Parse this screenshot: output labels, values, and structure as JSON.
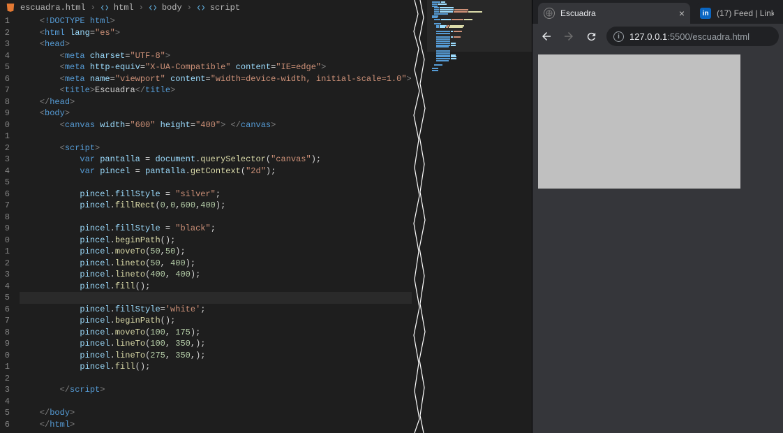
{
  "breadcrumbs": {
    "file": "escuadra.html",
    "path": [
      "html",
      "body",
      "script"
    ]
  },
  "code": {
    "lines": [
      {
        "n": "1",
        "kind": "tag",
        "indent": 1,
        "raw": "<!DOCTYPE html>"
      },
      {
        "n": "2",
        "kind": "tag",
        "indent": 1,
        "raw": "<html lang=\"es\">"
      },
      {
        "n": "3",
        "kind": "tag",
        "indent": 1,
        "raw": "<head>"
      },
      {
        "n": "4",
        "kind": "tag",
        "indent": 2,
        "raw": "<meta charset=\"UTF-8\">"
      },
      {
        "n": "5",
        "kind": "tag",
        "indent": 2,
        "raw": "<meta http-equiv=\"X-UA-Compatible\" content=\"IE=edge\">"
      },
      {
        "n": "6",
        "kind": "tag",
        "indent": 2,
        "raw": "<meta name=\"viewport\" content=\"width=device-width, initial-scale=1.0\">"
      },
      {
        "n": "7",
        "kind": "tag",
        "indent": 2,
        "raw": "<title>Escuadra</title>"
      },
      {
        "n": "8",
        "kind": "tag",
        "indent": 1,
        "raw": "</head>"
      },
      {
        "n": "9",
        "kind": "tag",
        "indent": 1,
        "raw": "<body>"
      },
      {
        "n": "0",
        "kind": "tag",
        "indent": 2,
        "raw": "<canvas width=\"600\" height=\"400\"> </canvas>"
      },
      {
        "n": "1",
        "kind": "blank",
        "indent": 0,
        "raw": ""
      },
      {
        "n": "2",
        "kind": "tag",
        "indent": 2,
        "raw": "<script>"
      },
      {
        "n": "3",
        "kind": "js",
        "indent": 3,
        "raw": "var pantalla = document.querySelector(\"canvas\");"
      },
      {
        "n": "4",
        "kind": "js",
        "indent": 3,
        "raw": "var pincel = pantalla.getContext(\"2d\");"
      },
      {
        "n": "5",
        "kind": "blank",
        "indent": 0,
        "raw": ""
      },
      {
        "n": "6",
        "kind": "js",
        "indent": 3,
        "raw": "pincel.fillStyle = \"silver\";"
      },
      {
        "n": "7",
        "kind": "js",
        "indent": 3,
        "raw": "pincel.fillRect(0,0,600,400);"
      },
      {
        "n": "8",
        "kind": "blank",
        "indent": 0,
        "raw": ""
      },
      {
        "n": "9",
        "kind": "js",
        "indent": 3,
        "raw": "pincel.fillStyle = \"black\";"
      },
      {
        "n": "0",
        "kind": "js",
        "indent": 3,
        "raw": "pincel.beginPath();"
      },
      {
        "n": "1",
        "kind": "js",
        "indent": 3,
        "raw": "pincel.moveTo(50,50);"
      },
      {
        "n": "2",
        "kind": "js",
        "indent": 3,
        "raw": "pincel.lineto(50, 400);"
      },
      {
        "n": "3",
        "kind": "js",
        "indent": 3,
        "raw": "pincel.lineto(400, 400);"
      },
      {
        "n": "4",
        "kind": "js",
        "indent": 3,
        "raw": "pincel.fill();"
      },
      {
        "n": "5",
        "kind": "blank",
        "indent": 0,
        "raw": "",
        "current": true
      },
      {
        "n": "6",
        "kind": "js",
        "indent": 3,
        "raw": "pincel.fillStyle='white';"
      },
      {
        "n": "7",
        "kind": "js",
        "indent": 3,
        "raw": "pincel.beginPath();"
      },
      {
        "n": "8",
        "kind": "js",
        "indent": 3,
        "raw": "pincel.moveTo(100, 175);"
      },
      {
        "n": "9",
        "kind": "js",
        "indent": 3,
        "raw": "pincel.lineTo(100, 350,);"
      },
      {
        "n": "0",
        "kind": "js",
        "indent": 3,
        "raw": "pincel.lineTo(275, 350,);"
      },
      {
        "n": "1",
        "kind": "js",
        "indent": 3,
        "raw": "pincel.fill();"
      },
      {
        "n": "2",
        "kind": "blank",
        "indent": 0,
        "raw": ""
      },
      {
        "n": "3",
        "kind": "tag",
        "indent": 2,
        "raw": "</script>"
      },
      {
        "n": "4",
        "kind": "blank",
        "indent": 0,
        "raw": ""
      },
      {
        "n": "5",
        "kind": "tag",
        "indent": 1,
        "raw": "</body>"
      },
      {
        "n": "6",
        "kind": "tag",
        "indent": 1,
        "raw": "</html>"
      }
    ]
  },
  "browser": {
    "active_tab_title": "Escuadra",
    "inactive_tab_title": "(17) Feed | Link",
    "url_host": "127.0.0.1",
    "url_port_path": ":5500/escuadra.html"
  }
}
